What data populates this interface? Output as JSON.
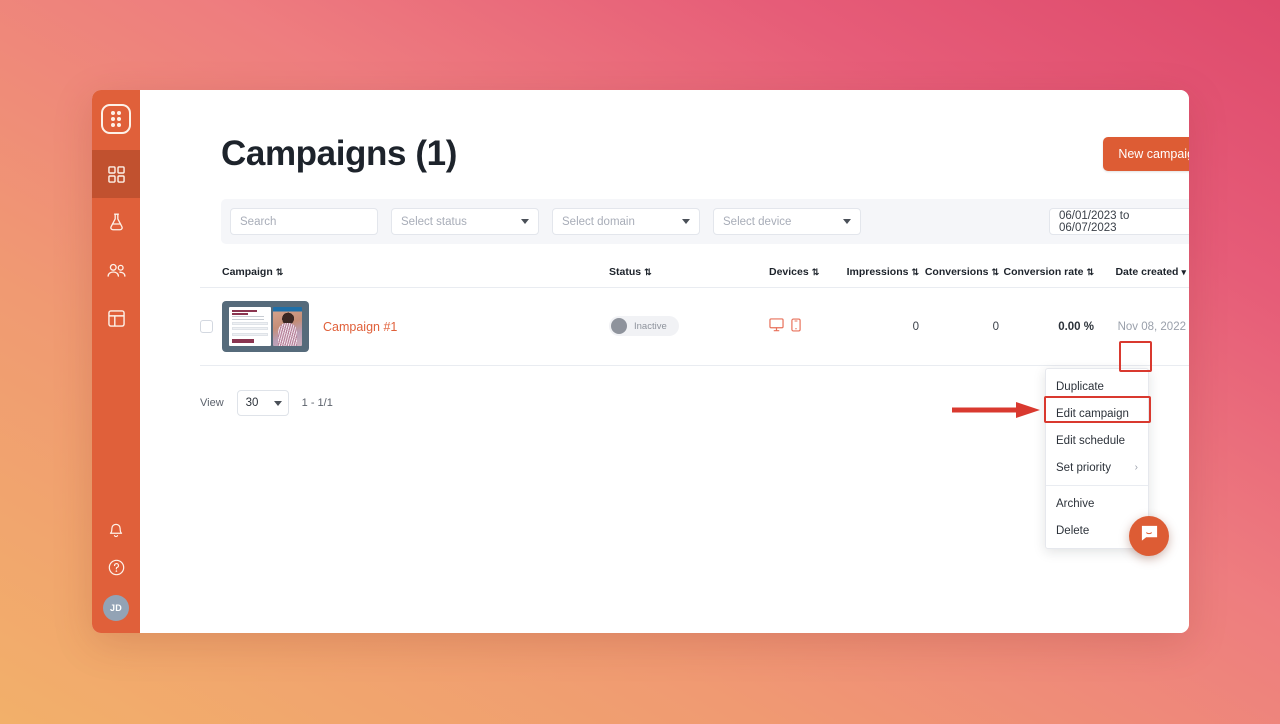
{
  "theme": {
    "brand_orange": "#e0603a",
    "button_orange": "#dd5c34",
    "annotation_red": "#d9392f",
    "link_orange": "#e0603a",
    "sidebar_active": "#c1512f"
  },
  "sidebar": {
    "logo_name": "app-logo-grid-icon",
    "items": [
      {
        "name": "dashboard",
        "icon": "grid-icon",
        "active": true
      },
      {
        "name": "experiments",
        "icon": "flask-icon",
        "active": false
      },
      {
        "name": "audiences",
        "icon": "people-icon",
        "active": false
      },
      {
        "name": "templates",
        "icon": "layout-icon",
        "active": false
      }
    ],
    "bottom": [
      {
        "name": "notifications",
        "icon": "bell-icon"
      },
      {
        "name": "help",
        "icon": "question-circle-icon"
      }
    ],
    "avatar_initials": "JD"
  },
  "header": {
    "title": "Campaigns (1)",
    "new_campaign_label": "New campaign"
  },
  "filters": {
    "search_placeholder": "Search",
    "status_placeholder": "Select status",
    "domain_placeholder": "Select domain",
    "device_placeholder": "Select device",
    "date_range": "06/01/2023 to 06/07/2023"
  },
  "table": {
    "columns": [
      {
        "key": "campaign",
        "label": "Campaign",
        "sort": "both"
      },
      {
        "key": "status",
        "label": "Status",
        "sort": "both"
      },
      {
        "key": "devices",
        "label": "Devices",
        "sort": "both"
      },
      {
        "key": "impressions",
        "label": "Impressions",
        "sort": "both"
      },
      {
        "key": "conversions",
        "label": "Conversions",
        "sort": "both"
      },
      {
        "key": "conversion_rate",
        "label": "Conversion rate",
        "sort": "both"
      },
      {
        "key": "date_created",
        "label": "Date created",
        "sort": "desc"
      }
    ],
    "sort_glyph_both": "⇅",
    "sort_glyph_desc": "▾",
    "rows": [
      {
        "name": "Campaign #1",
        "status_label": "Inactive",
        "status_active": false,
        "devices": [
          "desktop-icon",
          "mobile-icon"
        ],
        "impressions": "0",
        "conversions": "0",
        "conversion_rate": "0.00 %",
        "date_created": "Nov 08, 2022"
      }
    ]
  },
  "footer": {
    "view_label": "View",
    "page_size": "30",
    "range_label": "1 - 1/1"
  },
  "dropdown": {
    "items": [
      {
        "label": "Duplicate",
        "highlighted": false,
        "submenu": false
      },
      {
        "label": "Edit campaign",
        "highlighted": true,
        "submenu": false
      },
      {
        "label": "Edit schedule",
        "highlighted": false,
        "submenu": false
      },
      {
        "label": "Set priority",
        "highlighted": false,
        "submenu": true
      }
    ],
    "items_after_separator": [
      {
        "label": "Archive",
        "highlighted": false,
        "submenu": false
      },
      {
        "label": "Delete",
        "highlighted": false,
        "submenu": false
      }
    ],
    "submenu_glyph": "›"
  },
  "chat": {
    "icon": "chat-bubble-icon"
  }
}
